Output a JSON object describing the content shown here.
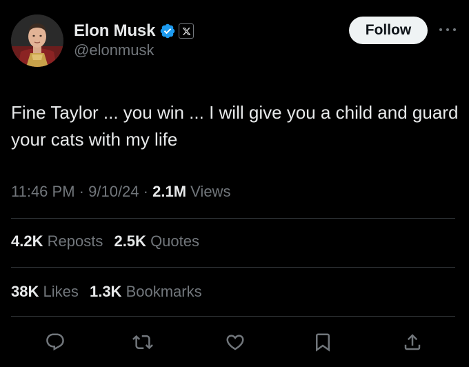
{
  "author": {
    "name": "Elon Musk",
    "handle": "@elonmusk",
    "verified": true,
    "verified_color": "#1d9bf0",
    "affiliation_badge": "x-logo-icon"
  },
  "header": {
    "follow_label": "Follow",
    "more_icon": "more-horizontal-icon"
  },
  "tweet": {
    "text": "Fine Taylor ... you win ... I will give you a child and guard your cats with my life"
  },
  "meta": {
    "time": "11:46 PM",
    "separator": "·",
    "date": "9/10/24",
    "views_count": "2.1M",
    "views_label": "Views"
  },
  "stats": {
    "reposts_count": "4.2K",
    "reposts_label": "Reposts",
    "quotes_count": "2.5K",
    "quotes_label": "Quotes",
    "likes_count": "38K",
    "likes_label": "Likes",
    "bookmarks_count": "1.3K",
    "bookmarks_label": "Bookmarks"
  },
  "actions": {
    "reply_icon": "reply-icon",
    "repost_icon": "repost-icon",
    "like_icon": "heart-icon",
    "bookmark_icon": "bookmark-icon",
    "share_icon": "share-icon"
  },
  "colors": {
    "background": "#000000",
    "text_primary": "#e7e9ea",
    "text_secondary": "#71767b",
    "divider": "#2f3336",
    "button_bg": "#eff3f4",
    "icon_gray": "#71767b"
  }
}
